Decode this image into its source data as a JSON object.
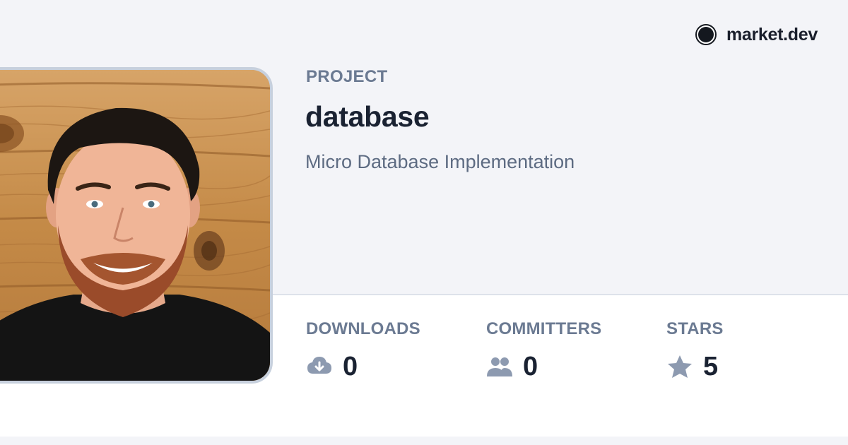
{
  "brand": {
    "name": "market.dev",
    "logo_icon": "filled-circle-logo"
  },
  "project": {
    "eyebrow": "PROJECT",
    "title": "database",
    "description": "Micro Database Implementation"
  },
  "stats": [
    {
      "label": "DOWNLOADS",
      "value": "0",
      "icon": "cloud-download-icon"
    },
    {
      "label": "COMMITTERS",
      "value": "0",
      "icon": "users-icon"
    },
    {
      "label": "STARS",
      "value": "5",
      "icon": "star-icon"
    }
  ],
  "colors": {
    "background": "#f3f4f8",
    "stats_background": "#ffffff",
    "muted_text": "#6b7a92",
    "strong_text": "#1a2232",
    "icon": "#8d9ab0",
    "avatar_border": "#c7d0dd"
  },
  "avatar": {
    "icon": "avatar-photo"
  }
}
